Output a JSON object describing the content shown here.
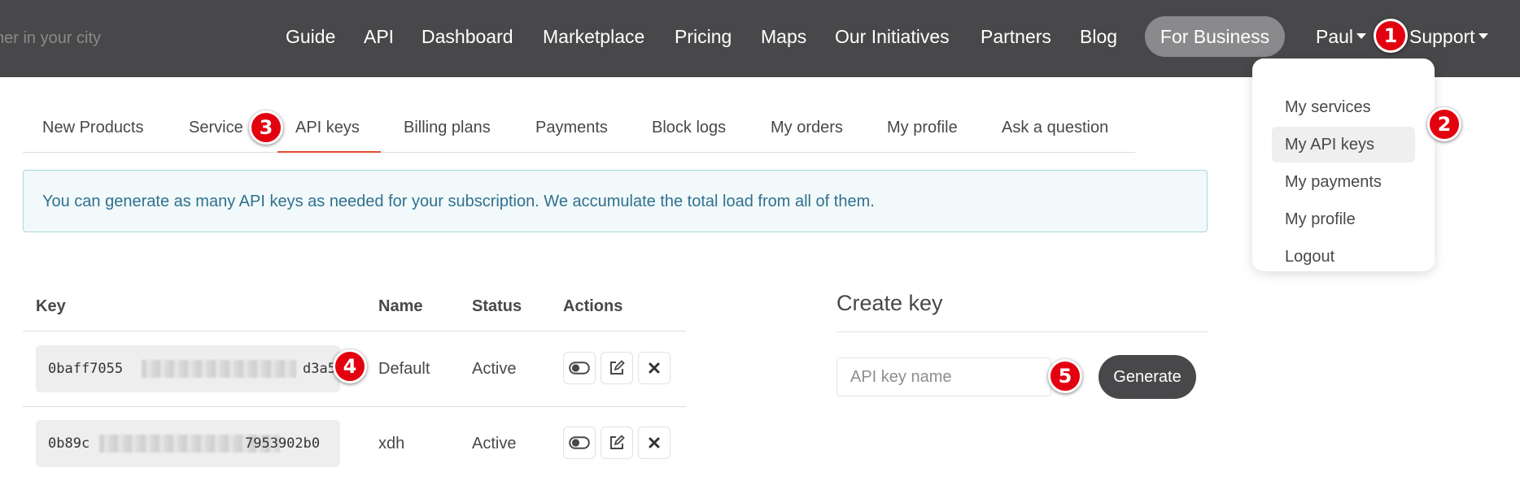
{
  "topbar": {
    "search_placeholder": "her in your city",
    "nav": [
      "Guide",
      "API",
      "Dashboard",
      "Marketplace",
      "Pricing",
      "Maps",
      "Our Initiatives",
      "Partners",
      "Blog"
    ],
    "for_business": "For Business",
    "user": "Paul",
    "support": "Support"
  },
  "user_menu": {
    "items": [
      "My services",
      "My API keys",
      "My payments",
      "My profile",
      "Logout"
    ],
    "active": "My API keys"
  },
  "tabs": {
    "items": [
      "New Products",
      "Service",
      "API keys",
      "Billing plans",
      "Payments",
      "Block logs",
      "My orders",
      "My profile",
      "Ask a question"
    ],
    "active": "API keys"
  },
  "alert": {
    "text": "You can generate as many API keys as needed for your subscription. We accumulate the total load from all of them."
  },
  "keys_table": {
    "headers": {
      "key": "Key",
      "name": "Name",
      "status": "Status",
      "actions": "Actions"
    },
    "rows": [
      {
        "key_start": "0baff7055",
        "key_end": "d3a5",
        "name": "Default",
        "status": "Active"
      },
      {
        "key_start": "0b89c",
        "key_end": "7953902b0",
        "name": "xdh",
        "status": "Active"
      }
    ]
  },
  "create_key": {
    "title": "Create key",
    "input_placeholder": "API key name",
    "button": "Generate"
  },
  "badges": [
    "1",
    "2",
    "3",
    "4",
    "5"
  ],
  "colors": {
    "nav_bg": "#48484a",
    "accent_tab": "#e24b31",
    "badge_red": "#e3000f",
    "alert_bg": "#f1f9fa",
    "alert_text": "#31708f"
  },
  "icons": [
    "toggle-icon",
    "edit-icon",
    "close-icon",
    "caret-down-icon"
  ]
}
